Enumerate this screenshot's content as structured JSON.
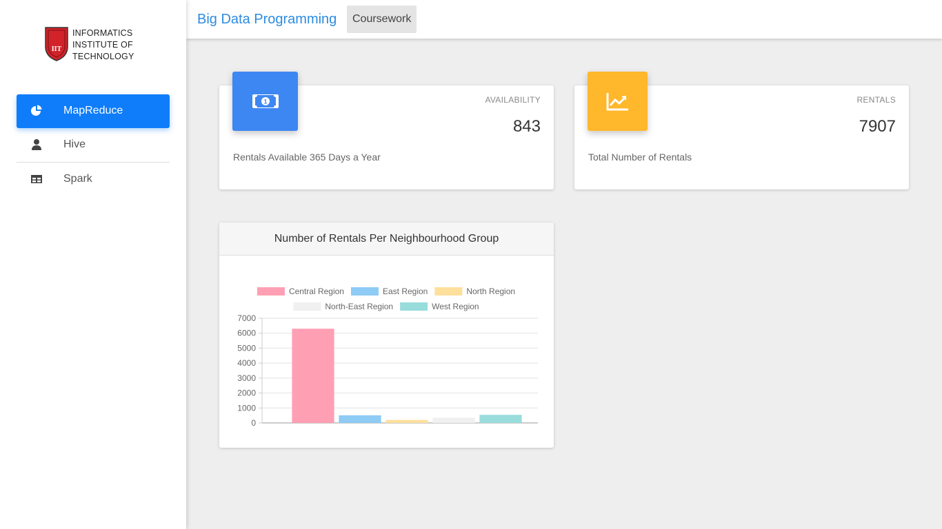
{
  "logo": {
    "line1": "INFORMATICS",
    "line2": "INSTITUTE OF",
    "line3": "TECHNOLOGY",
    "mark": "IIT"
  },
  "sidebar": {
    "items": [
      {
        "label": "MapReduce",
        "icon": "pie-chart-icon",
        "active": true
      },
      {
        "label": "Hive",
        "icon": "user-icon",
        "active": false
      },
      {
        "label": "Spark",
        "icon": "table-icon",
        "active": false
      }
    ]
  },
  "topbar": {
    "title": "Big Data Programming",
    "tab": "Coursework"
  },
  "cards": {
    "availability": {
      "label": "AVAILABILITY",
      "value": "843",
      "footer": "Rentals Available 365 Days a Year",
      "icon": "money-icon",
      "color": "#3d87f2"
    },
    "rentals": {
      "label": "RENTALS",
      "value": "7907",
      "footer": "Total Number of Rentals",
      "icon": "trending-up-icon",
      "color": "#ffb72b"
    }
  },
  "chart_card": {
    "title": "Number of Rentals Per Neighbourhood Group"
  },
  "chart_data": {
    "type": "bar",
    "title": "Number of Rentals Per Neighbourhood Group",
    "series": [
      {
        "name": "Central Region",
        "values": [
          6300
        ],
        "color": "#ff9fb3"
      },
      {
        "name": "East Region",
        "values": [
          510
        ],
        "color": "#8ecbf5"
      },
      {
        "name": "North Region",
        "values": [
          200
        ],
        "color": "#ffdf9c"
      },
      {
        "name": "North-East Region",
        "values": [
          350
        ],
        "color": "#f0f0f0"
      },
      {
        "name": "West Region",
        "values": [
          540
        ],
        "color": "#99dcdc"
      }
    ],
    "ylim": [
      0,
      7000
    ],
    "yticks": [
      "7000",
      "6000",
      "5000",
      "4000",
      "3000",
      "2000",
      "1000",
      "0"
    ],
    "grid": true,
    "legend_position": "top"
  }
}
